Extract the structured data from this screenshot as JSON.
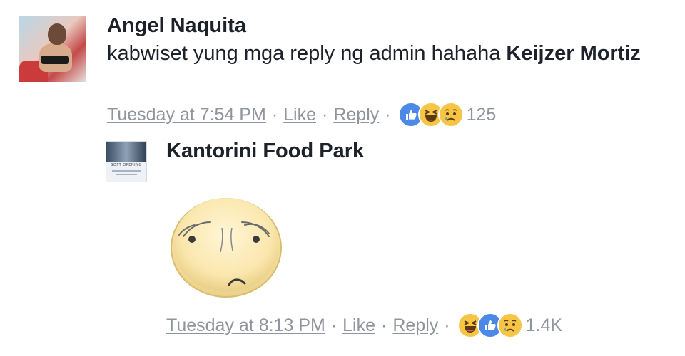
{
  "comment": {
    "author": "Angel Naquita",
    "text": "kabwiset yung mga reply ng admin hahaha ",
    "mention": "Keijzer Mortiz",
    "timestamp": "Tuesday at 7:54 PM",
    "like_label": "Like",
    "reply_label": "Reply",
    "reaction_icons": [
      "like-icon",
      "haha-icon",
      "sad-icon"
    ],
    "reaction_count": "125"
  },
  "reply": {
    "author": "Kantorini Food Park",
    "avatar_text": "SOFT OPENING",
    "sticker": "worried-face-sticker",
    "timestamp": "Tuesday at 8:13 PM",
    "like_label": "Like",
    "reply_label": "Reply",
    "reaction_icons": [
      "haha-icon",
      "like-icon",
      "sad-icon"
    ],
    "reaction_count": "1.4K"
  },
  "separator": "·",
  "colors": {
    "text": "#1d2129",
    "meta": "#90949c",
    "like_blue": "#4c88e8",
    "emoji_yellow": "#f7c545"
  }
}
